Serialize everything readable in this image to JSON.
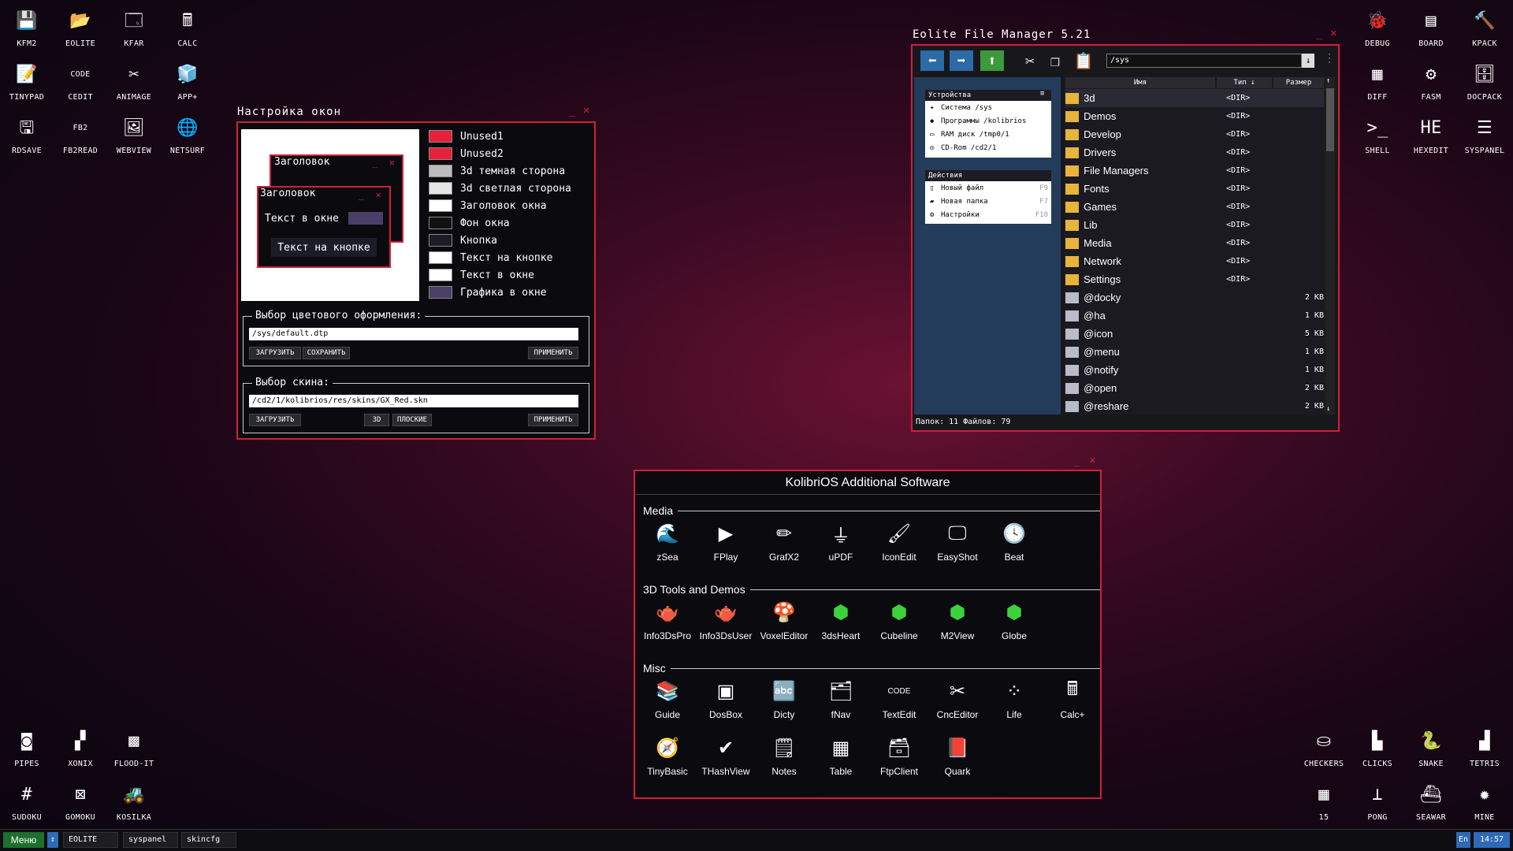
{
  "desktop_left_top": [
    {
      "label": "KFM2",
      "icon": "floppy-icon",
      "glyph": "💾"
    },
    {
      "label": "EOLITE",
      "icon": "folder-icon",
      "glyph": "📂"
    },
    {
      "label": "KFAR",
      "icon": "kfar-icon",
      "glyph": "🗔"
    },
    {
      "label": "CALC",
      "icon": "calculator-icon",
      "glyph": "🖩"
    },
    {
      "label": "TINYPAD",
      "icon": "notepad-icon",
      "glyph": "📝"
    },
    {
      "label": "CEDIT",
      "icon": "code-icon",
      "glyph": "CODE"
    },
    {
      "label": "ANIMAGE",
      "icon": "paint-icon",
      "glyph": "✂"
    },
    {
      "label": "APP+",
      "icon": "cube-icon",
      "glyph": "🧊"
    },
    {
      "label": "RDSAVE",
      "icon": "rdsave-icon",
      "glyph": "🖫"
    },
    {
      "label": "FB2READ",
      "icon": "book-icon",
      "glyph": "FB2"
    },
    {
      "label": "WEBVIEW",
      "icon": "webview-icon",
      "glyph": "🖼"
    },
    {
      "label": "NETSURF",
      "icon": "globe-icon",
      "glyph": "🌐"
    }
  ],
  "desktop_right_top": [
    {
      "label": "DEBUG",
      "icon": "bug-icon",
      "glyph": "🐞"
    },
    {
      "label": "BOARD",
      "icon": "board-icon",
      "glyph": "▤"
    },
    {
      "label": "KPACK",
      "icon": "pack-icon",
      "glyph": "🔨"
    },
    {
      "label": "DIFF",
      "icon": "diff-icon",
      "glyph": "▦"
    },
    {
      "label": "FASM",
      "icon": "fasm-icon",
      "glyph": "⚙"
    },
    {
      "label": "DOCPACK",
      "icon": "docpack-icon",
      "glyph": "🗄"
    },
    {
      "label": "SHELL",
      "icon": "terminal-icon",
      "glyph": ">_"
    },
    {
      "label": "HEXEDIT",
      "icon": "hex-icon",
      "glyph": "HE"
    },
    {
      "label": "SYSPANEL",
      "icon": "syspanel-icon",
      "glyph": "☰"
    }
  ],
  "desktop_left_bottom": [
    {
      "label": "PIPES",
      "icon": "pipes-icon",
      "glyph": "◙"
    },
    {
      "label": "XONIX",
      "icon": "xonix-icon",
      "glyph": "▞"
    },
    {
      "label": "FLOOD-IT",
      "icon": "flood-icon",
      "glyph": "▩"
    },
    {
      "label": "SUDOKU",
      "icon": "sudoku-icon",
      "glyph": "#"
    },
    {
      "label": "GOMOKU",
      "icon": "gomoku-icon",
      "glyph": "⊠"
    },
    {
      "label": "KOSILKA",
      "icon": "mower-icon",
      "glyph": "🚜"
    }
  ],
  "desktop_right_bottom": [
    {
      "label": "CHECKERS",
      "icon": "checkers-icon",
      "glyph": "⛀"
    },
    {
      "label": "CLICKS",
      "icon": "clicks-icon",
      "glyph": "▙"
    },
    {
      "label": "SNAKE",
      "icon": "snake-icon",
      "glyph": "🐍"
    },
    {
      "label": "TETRIS",
      "icon": "tetris-icon",
      "glyph": "▟"
    },
    {
      "label": "15",
      "icon": "fifteen-icon",
      "glyph": "▦"
    },
    {
      "label": "PONG",
      "icon": "pong-icon",
      "glyph": "⊥"
    },
    {
      "label": "SEAWAR",
      "icon": "ship-icon",
      "glyph": "⛴"
    },
    {
      "label": "MINE",
      "icon": "mine-icon",
      "glyph": "✹"
    }
  ],
  "skincfg": {
    "title": "Настройка окон",
    "preview_title_back": "Заголовок",
    "preview_title_front": "Заголовок",
    "preview_text": "Текст в окне",
    "preview_button": "Текст на кнопке",
    "colors": [
      {
        "label": "Unused1",
        "color": "#e8203c"
      },
      {
        "label": "Unused2",
        "color": "#e8203c"
      },
      {
        "label": "3d темная сторона",
        "color": "#bcbcbc"
      },
      {
        "label": "3d светлая сторона",
        "color": "#e6e6e6"
      },
      {
        "label": "Заголовок окна",
        "color": "#ffffff"
      },
      {
        "label": "Фон окна",
        "color": "#111111"
      },
      {
        "label": "Кнопка",
        "color": "#1c1c28"
      },
      {
        "label": "Текст на кнопке",
        "color": "#ffffff"
      },
      {
        "label": "Текст в окне",
        "color": "#ffffff"
      },
      {
        "label": "Графика в окне",
        "color": "#4a3f66"
      }
    ],
    "scheme_legend": "Выбор цветового оформления:",
    "scheme_path": "/sys/default.dtp",
    "scheme_load": "ЗАГРУЗИТЬ",
    "scheme_save": "СОХРАНИТЬ",
    "scheme_apply": "ПРИМЕНИТЬ",
    "skin_legend": "Выбор скина:",
    "skin_path": "/cd2/1/kolibrios/res/skins/GX_Red.skn",
    "skin_load": "ЗАГРУЗИТЬ",
    "skin_3d": "3D",
    "skin_flat": "ПЛОСКИЕ",
    "skin_apply": "ПРИМЕНИТЬ"
  },
  "eolite": {
    "title": "Eolite File Manager 5.21",
    "path": "/sys",
    "devices_header": "Устройства",
    "devices": [
      "Система /sys",
      "Программы /kolibrios",
      "RAM диск /tmp0/1",
      "CD-Rom /cd2/1"
    ],
    "actions_header": "Действия",
    "actions": [
      {
        "label": "Новый файл",
        "key": "F9"
      },
      {
        "label": "Новая папка",
        "key": "F7"
      },
      {
        "label": "Настройки",
        "key": "F10"
      }
    ],
    "col_name": "Имя",
    "col_type": "Тип ↓",
    "col_size": "Размер",
    "files": [
      {
        "name": "3d",
        "type": "<DIR>",
        "size": ""
      },
      {
        "name": "Demos",
        "type": "<DIR>",
        "size": ""
      },
      {
        "name": "Develop",
        "type": "<DIR>",
        "size": ""
      },
      {
        "name": "Drivers",
        "type": "<DIR>",
        "size": ""
      },
      {
        "name": "File Managers",
        "type": "<DIR>",
        "size": ""
      },
      {
        "name": "Fonts",
        "type": "<DIR>",
        "size": ""
      },
      {
        "name": "Games",
        "type": "<DIR>",
        "size": ""
      },
      {
        "name": "Lib",
        "type": "<DIR>",
        "size": ""
      },
      {
        "name": "Media",
        "type": "<DIR>",
        "size": ""
      },
      {
        "name": "Network",
        "type": "<DIR>",
        "size": ""
      },
      {
        "name": "Settings",
        "type": "<DIR>",
        "size": ""
      },
      {
        "name": "@docky",
        "type": "",
        "size": "2 KB"
      },
      {
        "name": "@ha",
        "type": "",
        "size": "1 KB"
      },
      {
        "name": "@icon",
        "type": "",
        "size": "5 KB"
      },
      {
        "name": "@menu",
        "type": "",
        "size": "1 KB"
      },
      {
        "name": "@notify",
        "type": "",
        "size": "1 KB"
      },
      {
        "name": "@open",
        "type": "",
        "size": "2 KB"
      },
      {
        "name": "@reshare",
        "type": "",
        "size": "2 KB"
      }
    ],
    "status": "Папок: 11   Файлов: 79"
  },
  "software": {
    "title": "KolibriOS Additional Software",
    "sections": [
      {
        "name": "Media",
        "apps": [
          {
            "label": "zSea",
            "icon": "zsea-icon",
            "glyph": "🌊"
          },
          {
            "label": "FPlay",
            "icon": "play-icon",
            "glyph": "▶"
          },
          {
            "label": "GrafX2",
            "icon": "grafx2-icon",
            "glyph": "✏"
          },
          {
            "label": "uPDF",
            "icon": "pdf-icon",
            "glyph": "⏚"
          },
          {
            "label": "IconEdit",
            "icon": "iconedit-icon",
            "glyph": "🖌"
          },
          {
            "label": "EasyShot",
            "icon": "screenshot-icon",
            "glyph": "🖵"
          },
          {
            "label": "Beat",
            "icon": "metronome-icon",
            "glyph": "🕓"
          }
        ]
      },
      {
        "name": "3D Tools and Demos",
        "apps": [
          {
            "label": "Info3DsPro",
            "icon": "teapot-icon",
            "glyph": "🫖"
          },
          {
            "label": "Info3DsUser",
            "icon": "teapot-icon",
            "glyph": "🫖"
          },
          {
            "label": "VoxelEditor",
            "icon": "mushroom-icon",
            "glyph": "🍄"
          },
          {
            "label": "3dsHeart",
            "icon": "gem-icon",
            "glyph": "⬢"
          },
          {
            "label": "Cubeline",
            "icon": "gem-icon",
            "glyph": "⬢"
          },
          {
            "label": "M2View",
            "icon": "gem-icon",
            "glyph": "⬢"
          },
          {
            "label": "Globe",
            "icon": "gem-icon",
            "glyph": "⬢"
          }
        ]
      },
      {
        "name": "Misc",
        "apps": [
          {
            "label": "Guide",
            "icon": "books-icon",
            "glyph": "📚"
          },
          {
            "label": "DosBox",
            "icon": "dosbox-icon",
            "glyph": "▣"
          },
          {
            "label": "Dicty",
            "icon": "dicty-icon",
            "glyph": "🔤"
          },
          {
            "label": "fNav",
            "icon": "fnav-icon",
            "glyph": "🗂"
          },
          {
            "label": "TextEdit",
            "icon": "code-icon",
            "glyph": "CODE"
          },
          {
            "label": "CncEditor",
            "icon": "cnc-icon",
            "glyph": "✂"
          },
          {
            "label": "Life",
            "icon": "life-icon",
            "glyph": "⁘"
          },
          {
            "label": "Calc+",
            "icon": "calculator-icon",
            "glyph": "🖩"
          },
          {
            "label": "TinyBasic",
            "icon": "basic-icon",
            "glyph": "🧭"
          },
          {
            "label": "THashView",
            "icon": "hash-icon",
            "glyph": "✔"
          },
          {
            "label": "Notes",
            "icon": "notes-icon",
            "glyph": "🗒"
          },
          {
            "label": "Table",
            "icon": "table-icon",
            "glyph": "▦"
          },
          {
            "label": "FtpClient",
            "icon": "ftp-icon",
            "glyph": "🗃"
          },
          {
            "label": "Quark",
            "icon": "quark-icon",
            "glyph": "📕"
          }
        ]
      }
    ]
  },
  "taskbar": {
    "menu": "Меню",
    "tasks": [
      "EOLITE",
      "syspanel",
      "skincfg"
    ],
    "lang": "En",
    "time": "14:57"
  }
}
